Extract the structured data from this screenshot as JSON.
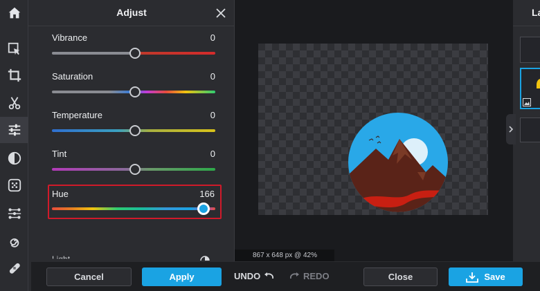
{
  "panel": {
    "title": "Adjust",
    "close_icon": "close-icon"
  },
  "toolbar": {
    "items": [
      {
        "icon": "home-icon"
      },
      {
        "icon": "select-arrow-icon"
      },
      {
        "icon": "crop-icon"
      },
      {
        "icon": "scissors-icon"
      },
      {
        "icon": "sliders-icon",
        "active": true
      },
      {
        "icon": "half-circle-contrast-icon"
      },
      {
        "icon": "dots-texture-icon"
      },
      {
        "icon": "nodes-icon"
      },
      {
        "icon": "spiral-icon"
      },
      {
        "icon": "bandage-icon"
      }
    ]
  },
  "sliders": [
    {
      "label": "Vibrance",
      "value": "0",
      "position": 0.5
    },
    {
      "label": "Saturation",
      "value": "0",
      "position": 0.5
    },
    {
      "label": "Temperature",
      "value": "0",
      "position": 0.5
    },
    {
      "label": "Tint",
      "value": "0",
      "position": 0.5
    },
    {
      "label": "Hue",
      "value": "166",
      "position": 0.95
    }
  ],
  "light_partial": "Light",
  "canvas": {
    "dimensions": "867 x 648 px @ 42%"
  },
  "layers": {
    "title": "La"
  },
  "bottom": {
    "cancel": "Cancel",
    "apply": "Apply",
    "undo": "UNDO",
    "redo": "REDO",
    "close": "Close",
    "save": "Save"
  },
  "colors": {
    "accent": "#1aa3e3",
    "highlight_border": "#d11a2a",
    "panel_bg": "#2b2c30"
  }
}
